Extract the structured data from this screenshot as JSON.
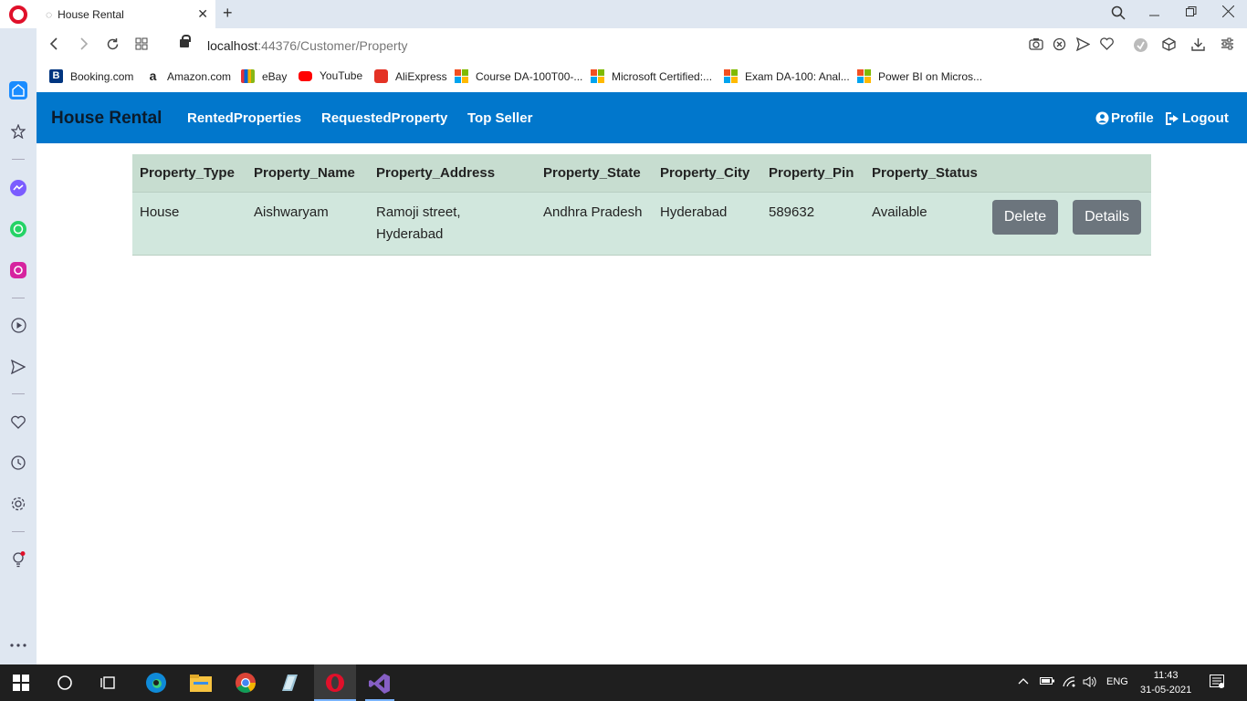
{
  "browser": {
    "tab_title": "House Rental",
    "tab_close": "✕",
    "new_tab": "+",
    "url_host": "localhost",
    "url_path": ":44376/Customer/Property",
    "bookmarks": [
      {
        "label": "Booking.com"
      },
      {
        "label": "Amazon.com"
      },
      {
        "label": "eBay"
      },
      {
        "label": "YouTube"
      },
      {
        "label": "AliExpress"
      },
      {
        "label": "Course DA-100T00-..."
      },
      {
        "label": "Microsoft Certified:..."
      },
      {
        "label": "Exam DA-100: Anal..."
      },
      {
        "label": "Power BI on Micros..."
      }
    ]
  },
  "navbar": {
    "brand": "House Rental",
    "links": [
      "RentedProperties",
      "RequestedProperty",
      "Top Seller"
    ],
    "profile": "Profile",
    "logout": "Logout"
  },
  "table": {
    "headers": [
      "Property_Type",
      "Property_Name",
      "Property_Address",
      "Property_State",
      "Property_City",
      "Property_Pin",
      "Property_Status"
    ],
    "rows": [
      {
        "type": "House",
        "name": "Aishwaryam",
        "address": "Ramoji street, Hyderabad",
        "state": "Andhra Pradesh",
        "city": "Hyderabad",
        "pin": "589632",
        "status": "Available",
        "delete_label": "Delete",
        "details_label": "Details"
      }
    ]
  },
  "taskbar": {
    "language": "ENG",
    "time": "11:43",
    "date": "31-05-2021"
  },
  "colors": {
    "navbar": "#0177cc",
    "table_header": "#c7ddd0",
    "table_row": "#d1e7dd",
    "button": "#6c757d"
  }
}
